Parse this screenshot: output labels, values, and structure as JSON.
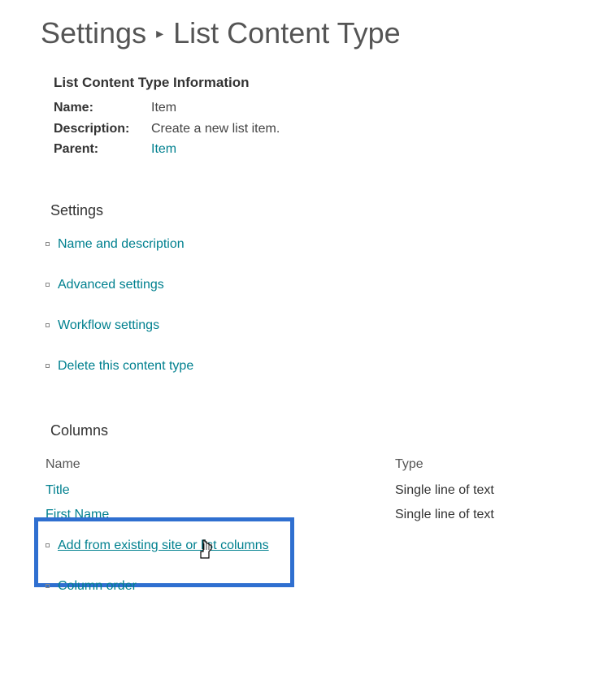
{
  "breadcrumb": {
    "root": "Settings",
    "current": "List Content Type"
  },
  "info": {
    "heading": "List Content Type Information",
    "rows": [
      {
        "label": "Name:",
        "value": "Item"
      },
      {
        "label": "Description:",
        "value": "Create a new list item."
      },
      {
        "label": "Parent:",
        "value": "Item",
        "is_link": true
      }
    ]
  },
  "settings": {
    "heading": "Settings",
    "links": [
      "Name and description",
      "Advanced settings",
      "Workflow settings",
      "Delete this content type"
    ]
  },
  "columns": {
    "heading": "Columns",
    "header": {
      "name": "Name",
      "type": "Type"
    },
    "rows": [
      {
        "name": "Title",
        "type": "Single line of text"
      },
      {
        "name": "First Name",
        "type": "Single line of text"
      }
    ],
    "actions": [
      "Add from existing site or list columns",
      "Column order"
    ]
  }
}
